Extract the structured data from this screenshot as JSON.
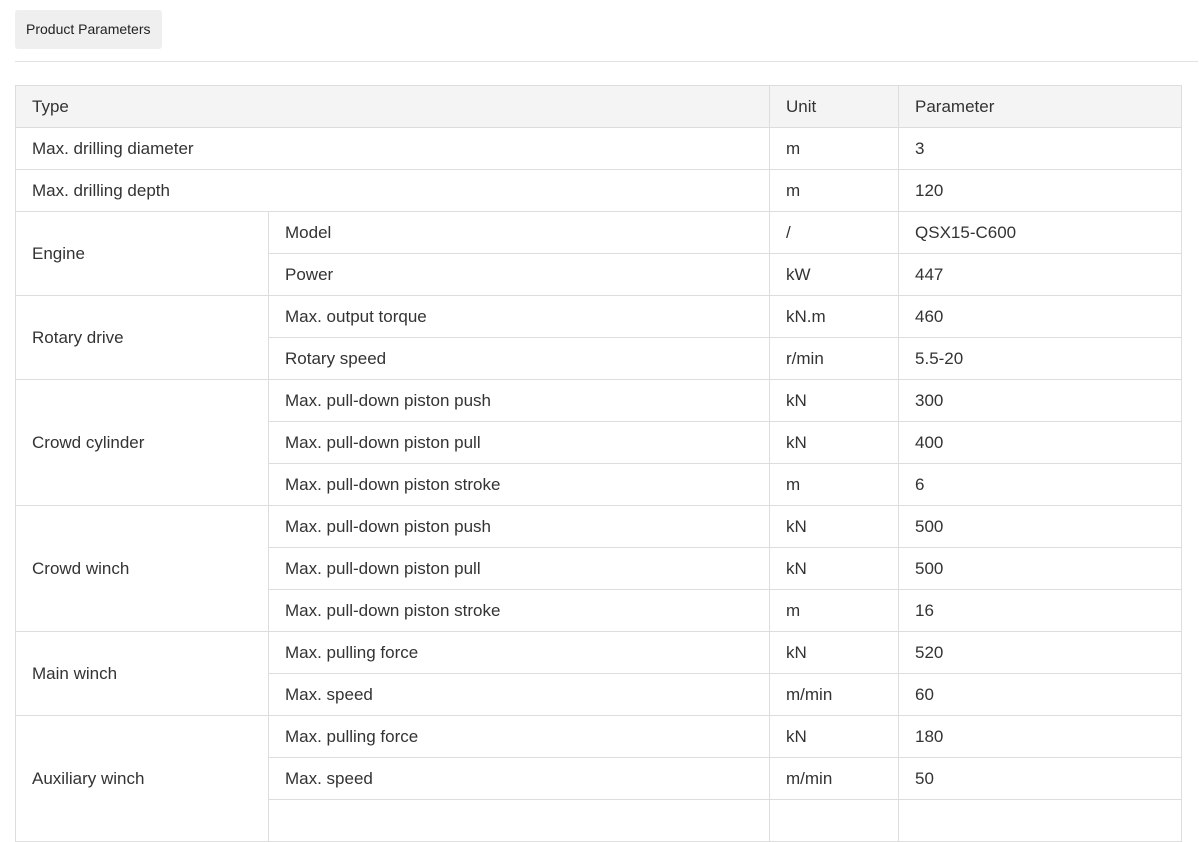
{
  "tab": {
    "label": "Product Parameters"
  },
  "table": {
    "headers": {
      "type": "Type",
      "unit": "Unit",
      "parameter": "Parameter"
    },
    "rows": [
      {
        "type": "Max. drilling diameter",
        "unit": "m",
        "value": "3"
      },
      {
        "type": "Max. drilling depth",
        "unit": "m",
        "value": "120"
      },
      {
        "group": "Engine",
        "sub": "Model",
        "unit": "/",
        "value": "QSX15-C600"
      },
      {
        "sub": "Power",
        "unit": "kW",
        "value": "447"
      },
      {
        "group": "Rotary drive",
        "sub": "Max. output torque",
        "unit": "kN.m",
        "value": "460"
      },
      {
        "sub": "Rotary speed",
        "unit": "r/min",
        "value": "5.5-20"
      },
      {
        "group": "Crowd cylinder",
        "sub": "Max. pull-down piston push",
        "unit": "kN",
        "value": "300"
      },
      {
        "sub": "Max. pull-down piston pull",
        "unit": "kN",
        "value": "400"
      },
      {
        "sub": "Max. pull-down piston stroke",
        "unit": "m",
        "value": "6"
      },
      {
        "group": "Crowd winch",
        "sub": "Max. pull-down piston push",
        "unit": "kN",
        "value": "500"
      },
      {
        "sub": "Max. pull-down piston pull",
        "unit": "kN",
        "value": "500"
      },
      {
        "sub": "Max. pull-down piston stroke",
        "unit": "m",
        "value": "16"
      },
      {
        "group": "Main winch",
        "sub": "Max. pulling force",
        "unit": "kN",
        "value": "520"
      },
      {
        "sub": "Max. speed",
        "unit": "m/min",
        "value": "60"
      },
      {
        "group": "Auxiliary winch",
        "sub": "Max. pulling force",
        "unit": "kN",
        "value": "180"
      },
      {
        "sub": "Max. speed",
        "unit": "m/min",
        "value": "50"
      }
    ]
  }
}
